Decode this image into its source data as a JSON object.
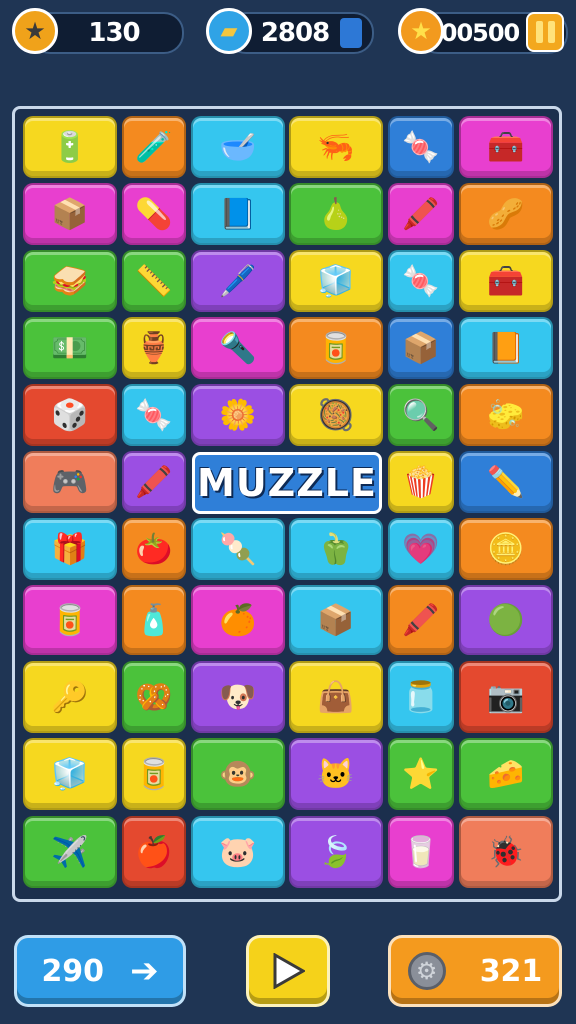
{
  "hud": {
    "stars": "130",
    "items": "2808",
    "score": "00500",
    "star_icon": "star-icon",
    "item_icon": "box-icon",
    "score_icon": "gold-star-icon",
    "pause_icon": "pause-icon"
  },
  "colors": {
    "yellow": "#f6d81f",
    "orange": "#f48a1f",
    "cyan": "#35c6ef",
    "magenta": "#e83fcf",
    "purple": "#9b4fe3",
    "green": "#4bc23b",
    "red": "#e4492f",
    "blue": "#2f7fd8",
    "salmon": "#f07d5b"
  },
  "board": {
    "title": "MUZZLE",
    "rows": [
      [
        {
          "c": "yellow",
          "i": "🔋"
        },
        {
          "c": "orange",
          "i": "🧪"
        },
        {
          "c": "cyan",
          "i": "🥣"
        },
        {
          "c": "yellow",
          "i": "🦐"
        },
        {
          "c": "blue",
          "i": "🍬"
        },
        {
          "c": "magenta",
          "i": "🧰"
        }
      ],
      [
        {
          "c": "magenta",
          "i": "📦"
        },
        {
          "c": "magenta",
          "i": "💊"
        },
        {
          "c": "cyan",
          "i": "📘"
        },
        {
          "c": "green",
          "i": "🍐"
        },
        {
          "c": "magenta",
          "i": "🖍️"
        },
        {
          "c": "orange",
          "i": "🥜"
        }
      ],
      [
        {
          "c": "green",
          "i": "🥪"
        },
        {
          "c": "green",
          "i": "📏"
        },
        {
          "c": "purple",
          "i": "🖊️"
        },
        {
          "c": "yellow",
          "i": "🧊"
        },
        {
          "c": "cyan",
          "i": "🍬"
        },
        {
          "c": "yellow",
          "i": "🧰"
        }
      ],
      [
        {
          "c": "green",
          "i": "💵"
        },
        {
          "c": "yellow",
          "i": "🏺"
        },
        {
          "c": "magenta",
          "i": "🔦"
        },
        {
          "c": "orange",
          "i": "🥫"
        },
        {
          "c": "blue",
          "i": "📦"
        },
        {
          "c": "cyan",
          "i": "📙"
        }
      ],
      [
        {
          "c": "red",
          "i": "🎲"
        },
        {
          "c": "cyan",
          "i": "🍬"
        },
        {
          "c": "purple",
          "i": "🌼"
        },
        {
          "c": "yellow",
          "i": "🥘"
        },
        {
          "c": "green",
          "i": "🔍"
        },
        {
          "c": "orange",
          "i": "🧽"
        }
      ],
      [
        {
          "c": "salmon",
          "i": "🎮"
        },
        {
          "c": "purple",
          "i": "🖍️"
        },
        null,
        null,
        {
          "c": "yellow",
          "i": "🍿"
        },
        {
          "c": "blue",
          "i": "✏️"
        }
      ],
      [
        {
          "c": "cyan",
          "i": "🎁"
        },
        {
          "c": "orange",
          "i": "🍅"
        },
        {
          "c": "cyan",
          "i": "🍡"
        },
        {
          "c": "cyan",
          "i": "🫑"
        },
        {
          "c": "cyan",
          "i": "💗"
        },
        {
          "c": "orange",
          "i": "🪙"
        }
      ],
      [
        {
          "c": "magenta",
          "i": "🥫"
        },
        {
          "c": "orange",
          "i": "🧴"
        },
        {
          "c": "magenta",
          "i": "🍊"
        },
        {
          "c": "cyan",
          "i": "📦"
        },
        {
          "c": "orange",
          "i": "🖍️"
        },
        {
          "c": "purple",
          "i": "🟢"
        }
      ],
      [
        {
          "c": "yellow",
          "i": "🔑"
        },
        {
          "c": "green",
          "i": "🥨"
        },
        {
          "c": "purple",
          "i": "🐶"
        },
        {
          "c": "yellow",
          "i": "👜"
        },
        {
          "c": "cyan",
          "i": "🫙"
        },
        {
          "c": "red",
          "i": "📷"
        }
      ],
      [
        {
          "c": "yellow",
          "i": "🧊"
        },
        {
          "c": "yellow",
          "i": "🥫"
        },
        {
          "c": "green",
          "i": "🐵"
        },
        {
          "c": "purple",
          "i": "🐱"
        },
        {
          "c": "green",
          "i": "⭐"
        },
        {
          "c": "green",
          "i": "🧀"
        }
      ],
      [
        {
          "c": "green",
          "i": "✈️"
        },
        {
          "c": "red",
          "i": "🍎"
        },
        {
          "c": "cyan",
          "i": "🐷"
        },
        {
          "c": "purple",
          "i": "🍃"
        },
        {
          "c": "magenta",
          "i": "🥛"
        },
        {
          "c": "salmon",
          "i": "🐞"
        }
      ]
    ]
  },
  "controls": {
    "left_label": "290",
    "left_icon": "arrow-right-icon",
    "play_icon": "play-icon",
    "right_label": "321",
    "right_icon": "gear-icon"
  }
}
